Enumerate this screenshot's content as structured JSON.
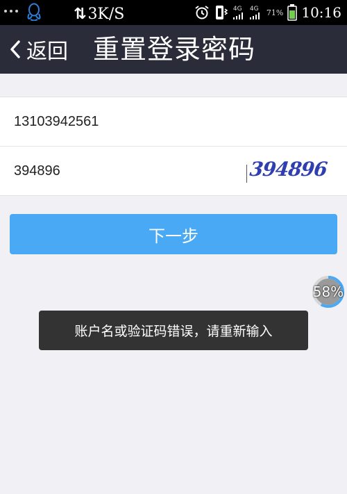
{
  "status_bar": {
    "network_speed": "3K/S",
    "network_type_1": "4G",
    "network_type_2": "4G",
    "battery_percent": "71%",
    "time": "10:16",
    "icons": [
      "more-dots-icon",
      "qq-icon",
      "data-transfer-icon",
      "alarm-icon",
      "vibrate-icon",
      "signal-icon",
      "battery-icon"
    ]
  },
  "header": {
    "back_label": "返回",
    "title": "重置登录密码",
    "background_color": "#2a2d39"
  },
  "form": {
    "phone_value": "13103942561",
    "code_value": "394896",
    "captcha_text": "394896"
  },
  "next_button": {
    "label": "下一步",
    "color": "#4aa9f5"
  },
  "progress": {
    "label": "58%",
    "value": 58
  },
  "toast": {
    "message": "账户名或验证码错误，请重新输入"
  }
}
